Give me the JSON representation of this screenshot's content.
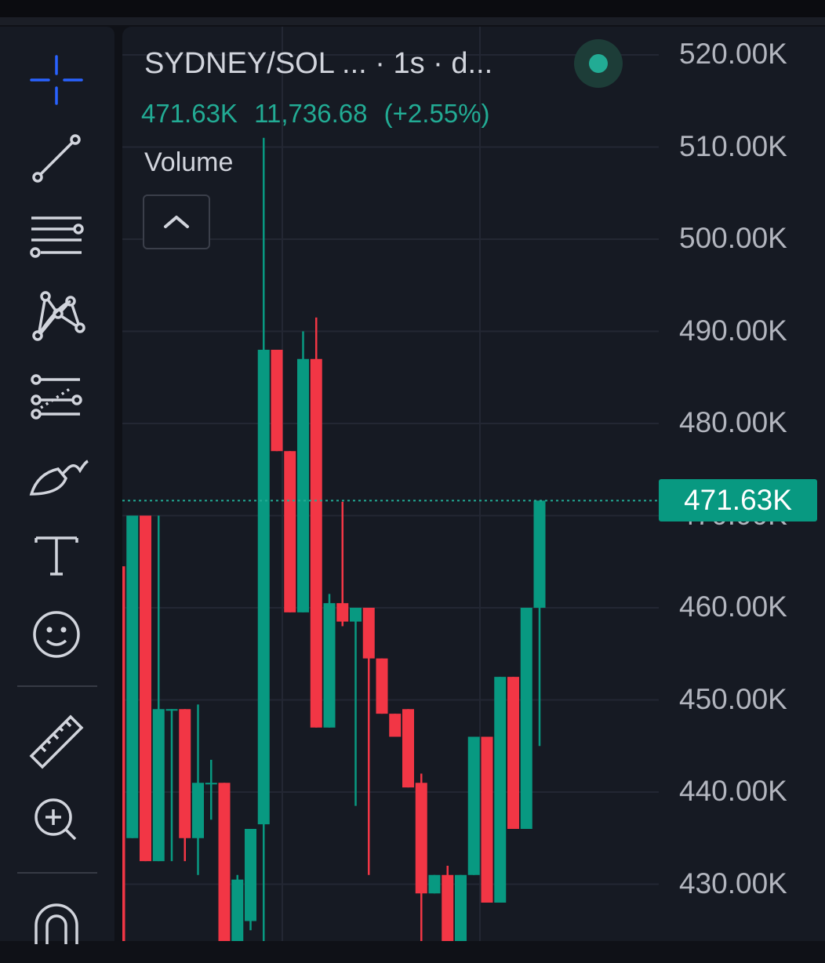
{
  "legend": {
    "title": "SYDNEY/SOL ...  · 1s · d...",
    "last_price": "471.63K",
    "change": "11,736.68",
    "change_pct": "(+2.55%)",
    "volume_label": "Volume"
  },
  "price_badge": "471.63K",
  "colors": {
    "up": "#089981",
    "down": "#f23645",
    "accent": "#2962ff",
    "background": "#161a23",
    "text": "#d1d4dc"
  },
  "toolbar": {
    "tools": [
      {
        "name": "crosshair-icon"
      },
      {
        "name": "trend-line-icon"
      },
      {
        "name": "parallel-lines-icon"
      },
      {
        "name": "pattern-icon"
      },
      {
        "name": "fib-retracement-icon"
      },
      {
        "name": "brush-icon"
      },
      {
        "name": "text-icon"
      },
      {
        "name": "emoji-icon"
      },
      {
        "name": "ruler-icon"
      },
      {
        "name": "zoom-in-icon"
      },
      {
        "name": "magnet-icon"
      }
    ]
  },
  "chart_data": {
    "type": "candlestick",
    "symbol": "SYDNEY/SOL",
    "interval": "1s",
    "y_axis": {
      "ticks": [
        "520.00K",
        "510.00K",
        "500.00K",
        "490.00K",
        "480.00K",
        "470.00K",
        "460.00K",
        "450.00K",
        "440.00K",
        "430.00K"
      ],
      "range": [
        420,
        524
      ],
      "unit": "K"
    },
    "last_price": 471.63,
    "candles": [
      {
        "o": 464.5,
        "h": 464.5,
        "l": 420.0,
        "c": 420.0
      },
      {
        "o": 435.0,
        "h": 470.0,
        "l": 435.0,
        "c": 470.0
      },
      {
        "o": 470.0,
        "h": 470.0,
        "l": 432.5,
        "c": 432.5
      },
      {
        "o": 432.5,
        "h": 470.0,
        "l": 432.5,
        "c": 449.0
      },
      {
        "o": 449.0,
        "h": 449.0,
        "l": 432.5,
        "c": 449.0
      },
      {
        "o": 449.0,
        "h": 449.0,
        "l": 432.5,
        "c": 435.0
      },
      {
        "o": 435.0,
        "h": 449.5,
        "l": 431.0,
        "c": 441.0
      },
      {
        "o": 441.0,
        "h": 443.5,
        "l": 437.0,
        "c": 441.0
      },
      {
        "o": 441.0,
        "h": 441.0,
        "l": 420.0,
        "c": 420.0
      },
      {
        "o": 420.0,
        "h": 431.0,
        "l": 420.0,
        "c": 430.5
      },
      {
        "o": 426.0,
        "h": 436.0,
        "l": 425.0,
        "c": 436.0
      },
      {
        "o": 436.5,
        "h": 511.0,
        "l": 420.0,
        "c": 488.0
      },
      {
        "o": 488.0,
        "h": 488.0,
        "l": 477.0,
        "c": 477.0
      },
      {
        "o": 477.0,
        "h": 477.0,
        "l": 459.5,
        "c": 459.5
      },
      {
        "o": 459.5,
        "h": 490.0,
        "l": 459.5,
        "c": 487.0
      },
      {
        "o": 487.0,
        "h": 491.5,
        "l": 447.0,
        "c": 447.0
      },
      {
        "o": 447.0,
        "h": 461.5,
        "l": 447.0,
        "c": 460.5
      },
      {
        "o": 460.5,
        "h": 471.5,
        "l": 458.0,
        "c": 458.5
      },
      {
        "o": 458.5,
        "h": 460.0,
        "l": 438.5,
        "c": 460.0
      },
      {
        "o": 460.0,
        "h": 460.0,
        "l": 431.0,
        "c": 454.5
      },
      {
        "o": 454.5,
        "h": 454.5,
        "l": 448.5,
        "c": 448.5
      },
      {
        "o": 448.5,
        "h": 448.5,
        "l": 446.0,
        "c": 446.0
      },
      {
        "o": 449.0,
        "h": 449.0,
        "l": 440.5,
        "c": 440.5
      },
      {
        "o": 441.0,
        "h": 442.0,
        "l": 420.0,
        "c": 429.0
      },
      {
        "o": 429.0,
        "h": 431.0,
        "l": 429.0,
        "c": 431.0
      },
      {
        "o": 431.0,
        "h": 432.0,
        "l": 420.0,
        "c": 420.0
      },
      {
        "o": 420.0,
        "h": 431.0,
        "l": 420.0,
        "c": 431.0
      },
      {
        "o": 431.0,
        "h": 446.0,
        "l": 431.0,
        "c": 446.0
      },
      {
        "o": 446.0,
        "h": 446.0,
        "l": 428.0,
        "c": 428.0
      },
      {
        "o": 428.0,
        "h": 452.5,
        "l": 428.0,
        "c": 452.5
      },
      {
        "o": 452.5,
        "h": 452.5,
        "l": 436.0,
        "c": 436.0
      },
      {
        "o": 436.0,
        "h": 460.0,
        "l": 436.0,
        "c": 460.0
      },
      {
        "o": 460.0,
        "h": 471.63,
        "l": 445.0,
        "c": 471.63
      }
    ]
  }
}
